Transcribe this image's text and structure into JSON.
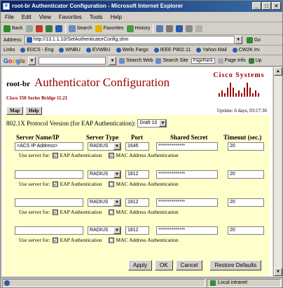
{
  "window": {
    "title": "root-br Authenticator Configuration - Microsoft Internet Explorer",
    "controls": [
      "_",
      "□",
      "×"
    ]
  },
  "menu": [
    "File",
    "Edit",
    "View",
    "Favorites",
    "Tools",
    "Help"
  ],
  "toolbar": {
    "back": "Back",
    "search": "Search",
    "favorites": "Favorites",
    "history": "History"
  },
  "address": {
    "label": "Address",
    "url": "http://13.1.1.10/SetAuthenticatorConfig.shm",
    "go": "Go"
  },
  "links": {
    "label": "Links",
    "items": [
      "EDCS - Eng",
      "WNBU",
      "EVWBU",
      "Wells Fargo",
      "IEEE P802.11",
      "Yahoo Mail",
      "CW2K Irv"
    ]
  },
  "google": {
    "logo": [
      "G",
      "o",
      "o",
      "g",
      "l",
      "e"
    ],
    "search_web": "Search Web",
    "search_site": "Search Site",
    "pagerank": "PageRank",
    "page_info": "Page Info",
    "up": "Up"
  },
  "page": {
    "hostname": "root-br",
    "title": "Authenticator Configuration",
    "model": "Cisco 350 Series Bridge 11.21",
    "brand": "Cisco Systems",
    "nav": [
      "Map",
      "Help"
    ],
    "uptime": "Uptime: 6 days, 03:17:36",
    "protocol_label": "802.1X Protocol Version (for EAP Authentication):",
    "protocol_value": "Draft 10",
    "columns": [
      "Server Name/IP",
      "Server Type",
      "Port",
      "Shared Secret",
      "Timeout (sec.)"
    ],
    "use_for_label": "Use server for:",
    "eap_label": "EAP Authentication",
    "mac_label": "MAC Address Authentication",
    "servers": [
      {
        "name": "<ACS IP Address>",
        "type": "RADIUS",
        "port": "1645",
        "secret": "**************",
        "timeout": "20",
        "eap": "☑",
        "mac": "☑"
      },
      {
        "name": "",
        "type": "RADIUS",
        "port": "1812",
        "secret": "**************",
        "timeout": "20",
        "eap": "☑",
        "mac": "☐"
      },
      {
        "name": "",
        "type": "RADIUS",
        "port": "1812",
        "secret": "**************",
        "timeout": "20",
        "eap": "☑",
        "mac": "☐"
      },
      {
        "name": "",
        "type": "RADIUS",
        "port": "1812",
        "secret": "**************",
        "timeout": "20",
        "eap": "☑",
        "mac": "☐"
      }
    ],
    "buttons": [
      "Apply",
      "OK",
      "Cancel",
      "Restore Defaults"
    ]
  },
  "status": {
    "zone": "Local intranet"
  }
}
